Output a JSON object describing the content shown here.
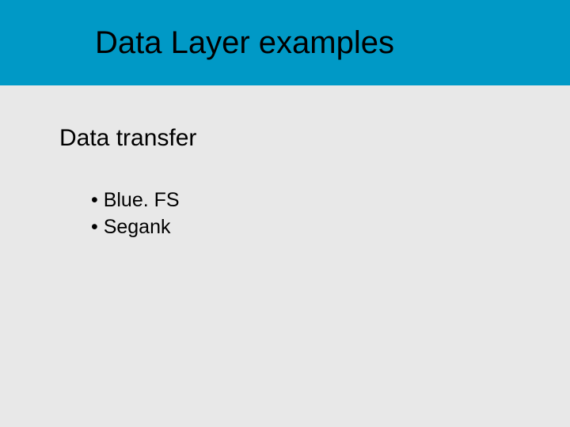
{
  "header": {
    "title": "Data Layer examples"
  },
  "content": {
    "subtitle": "Data transfer",
    "bullets": [
      {
        "text": "Blue. FS"
      },
      {
        "text": "Segank"
      }
    ]
  }
}
